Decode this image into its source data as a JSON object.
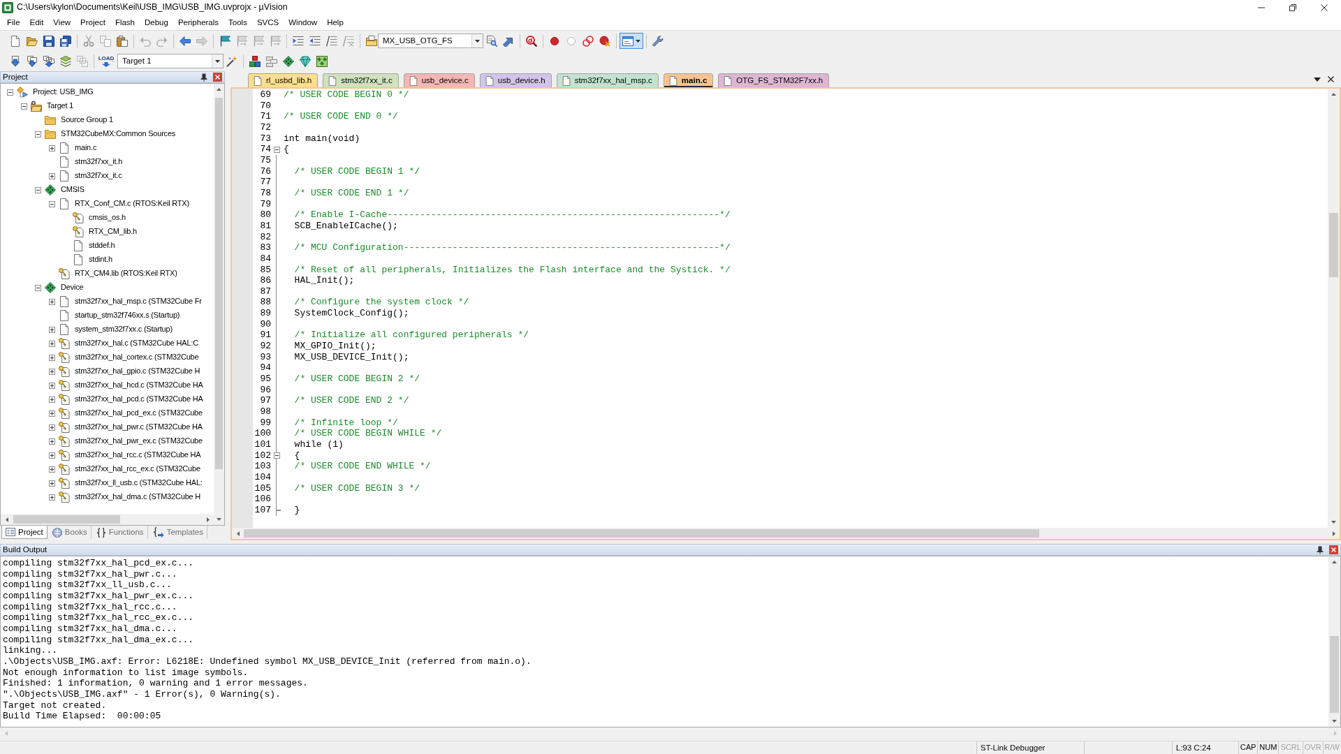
{
  "window": {
    "title": "C:\\Users\\kylon\\Documents\\Keil\\USB_IMG\\USB_IMG.uvprojx - µVision"
  },
  "menu": [
    "File",
    "Edit",
    "View",
    "Project",
    "Flash",
    "Debug",
    "Peripherals",
    "Tools",
    "SVCS",
    "Window",
    "Help"
  ],
  "toolbar_1": {
    "find_combo": {
      "value": "MX_USB_OTG_FS"
    },
    "window_button": {
      "on": true
    }
  },
  "toolbar_2": {
    "load_button": {
      "label": "LOAD"
    },
    "target_combo": {
      "value": "Target 1"
    }
  },
  "project_panel": {
    "title": "Project",
    "tree": [
      {
        "label": "Project: USB_IMG",
        "kind": "project",
        "expanded": true,
        "children": [
          {
            "label": "Target 1",
            "kind": "target",
            "expanded": true,
            "children": [
              {
                "label": "Source Group 1",
                "kind": "folder"
              },
              {
                "label": "STM32CubeMX:Common Sources",
                "kind": "folder",
                "expanded": true,
                "children": [
                  {
                    "label": "main.c",
                    "kind": "file",
                    "expanded": false
                  },
                  {
                    "label": "stm32f7xx_it.h",
                    "kind": "file"
                  },
                  {
                    "label": "stm32f7xx_it.c",
                    "kind": "file",
                    "expanded": false
                  }
                ]
              },
              {
                "label": "CMSIS",
                "kind": "component",
                "expanded": true,
                "children": [
                  {
                    "label": "RTX_Conf_CM.c (RTOS:Keil RTX)",
                    "kind": "file",
                    "expanded": true,
                    "children": [
                      {
                        "label": "cmsis_os.h",
                        "kind": "keyfile"
                      },
                      {
                        "label": "RTX_CM_lib.h",
                        "kind": "keyfile"
                      },
                      {
                        "label": "stddef.h",
                        "kind": "file"
                      },
                      {
                        "label": "stdint.h",
                        "kind": "file"
                      }
                    ]
                  },
                  {
                    "label": "RTX_CM4.lib (RTOS:Keil RTX)",
                    "kind": "keyfile"
                  }
                ]
              },
              {
                "label": "Device",
                "kind": "component",
                "expanded": true,
                "children": [
                  {
                    "label": "stm32f7xx_hal_msp.c (STM32Cube Fr",
                    "kind": "file",
                    "expanded": false
                  },
                  {
                    "label": "startup_stm32f746xx.s (Startup)",
                    "kind": "file"
                  },
                  {
                    "label": "system_stm32f7xx.c (Startup)",
                    "kind": "file",
                    "expanded": false
                  },
                  {
                    "label": "stm32f7xx_hal.c (STM32Cube HAL:C",
                    "kind": "keyfile",
                    "expanded": false
                  },
                  {
                    "label": "stm32f7xx_hal_cortex.c (STM32Cube",
                    "kind": "keyfile",
                    "expanded": false
                  },
                  {
                    "label": "stm32f7xx_hal_gpio.c (STM32Cube H",
                    "kind": "keyfile",
                    "expanded": false
                  },
                  {
                    "label": "stm32f7xx_hal_hcd.c (STM32Cube HA",
                    "kind": "keyfile",
                    "expanded": false
                  },
                  {
                    "label": "stm32f7xx_hal_pcd.c (STM32Cube HA",
                    "kind": "keyfile",
                    "expanded": false
                  },
                  {
                    "label": "stm32f7xx_hal_pcd_ex.c (STM32Cube",
                    "kind": "keyfile",
                    "expanded": false
                  },
                  {
                    "label": "stm32f7xx_hal_pwr.c (STM32Cube HA",
                    "kind": "keyfile",
                    "expanded": false
                  },
                  {
                    "label": "stm32f7xx_hal_pwr_ex.c (STM32Cube",
                    "kind": "keyfile",
                    "expanded": false
                  },
                  {
                    "label": "stm32f7xx_hal_rcc.c (STM32Cube HA",
                    "kind": "keyfile",
                    "expanded": false
                  },
                  {
                    "label": "stm32f7xx_hal_rcc_ex.c (STM32Cube",
                    "kind": "keyfile",
                    "expanded": false
                  },
                  {
                    "label": "stm32f7xx_ll_usb.c (STM32Cube HAL:",
                    "kind": "keyfile",
                    "expanded": false
                  },
                  {
                    "label": "stm32f7xx_hal_dma.c (STM32Cube H",
                    "kind": "keyfile",
                    "expanded": false
                  }
                ]
              }
            ]
          }
        ]
      }
    ],
    "tabs": [
      {
        "label": "Project",
        "selected": true
      },
      {
        "label": "Books",
        "selected": false
      },
      {
        "label": "Functions",
        "selected": false
      },
      {
        "label": "Templates",
        "selected": false
      }
    ]
  },
  "editor": {
    "tabs": [
      {
        "label": "rl_usbd_lib.h",
        "color": "#fcdf8e",
        "selected": false
      },
      {
        "label": "stm32f7xx_it.c",
        "color": "#cfe2bd",
        "selected": false
      },
      {
        "label": "usb_device.c",
        "color": "#f5b7b5",
        "selected": false
      },
      {
        "label": "usb_device.h",
        "color": "#d2c4ec",
        "selected": false
      },
      {
        "label": "stm32f7xx_hal_msp.c",
        "color": "#c3e3d2",
        "selected": false
      },
      {
        "label": "main.c",
        "color": "#f9c492",
        "selected": true
      },
      {
        "label": "OTG_FS_STM32F7xx.h",
        "color": "#deb6d1",
        "selected": false
      }
    ],
    "lines": [
      {
        "number": "69",
        "text": "/* USER CODE BEGIN 0 */",
        "kind": "comment"
      },
      {
        "number": "70"
      },
      {
        "number": "71",
        "text": "/* USER CODE END 0 */",
        "kind": "comment"
      },
      {
        "number": "72"
      },
      {
        "number": "73",
        "text": "int main(void)",
        "kind": "code"
      },
      {
        "number": "74",
        "text": "{",
        "kind": "code",
        "expanded": true
      },
      {
        "number": "75"
      },
      {
        "number": "76",
        "text": "  /* USER CODE BEGIN 1 */",
        "kind": "comment"
      },
      {
        "number": "77"
      },
      {
        "number": "78",
        "text": "  /* USER CODE END 1 */",
        "kind": "comment"
      },
      {
        "number": "79"
      },
      {
        "number": "80",
        "text": "  /* Enable I-Cache-------------------------------------------------------------*/",
        "kind": "comment"
      },
      {
        "number": "81",
        "text": "  SCB_EnableICache();",
        "kind": "code"
      },
      {
        "number": "82"
      },
      {
        "number": "83",
        "text": "  /* MCU Configuration----------------------------------------------------------*/",
        "kind": "comment"
      },
      {
        "number": "84"
      },
      {
        "number": "85",
        "text": "  /* Reset of all peripherals, Initializes the Flash interface and the Systick. */",
        "kind": "comment"
      },
      {
        "number": "86",
        "text": "  HAL_Init();",
        "kind": "code"
      },
      {
        "number": "87"
      },
      {
        "number": "88",
        "text": "  /* Configure the system clock */",
        "kind": "comment"
      },
      {
        "number": "89",
        "text": "  SystemClock_Config();",
        "kind": "code"
      },
      {
        "number": "90"
      },
      {
        "number": "91",
        "text": "  /* Initialize all configured peripherals */",
        "kind": "comment"
      },
      {
        "number": "92",
        "text": "  MX_GPIO_Init();",
        "kind": "code"
      },
      {
        "number": "93",
        "text": "  MX_USB_DEVICE_Init();",
        "kind": "code"
      },
      {
        "number": "94"
      },
      {
        "number": "95",
        "text": "  /* USER CODE BEGIN 2 */",
        "kind": "comment"
      },
      {
        "number": "96"
      },
      {
        "number": "97",
        "text": "  /* USER CODE END 2 */",
        "kind": "comment"
      },
      {
        "number": "98"
      },
      {
        "number": "99",
        "text": "  /* Infinite loop */",
        "kind": "comment"
      },
      {
        "number": "100",
        "text": "  /* USER CODE BEGIN WHILE */",
        "kind": "comment"
      },
      {
        "number": "101",
        "text": "  while (1)",
        "kind": "code"
      },
      {
        "number": "102",
        "text": "  {",
        "kind": "code",
        "expanded": true
      },
      {
        "number": "103",
        "text": "  /* USER CODE END WHILE */",
        "kind": "comment"
      },
      {
        "number": "104"
      },
      {
        "number": "105",
        "text": "  /* USER CODE BEGIN 3 */",
        "kind": "comment"
      },
      {
        "number": "106"
      },
      {
        "number": "107",
        "text": "  }",
        "kind": "code",
        "fold_end": true
      }
    ]
  },
  "build_output": {
    "title": "Build Output",
    "lines": [
      "compiling stm32f7xx_hal_pcd_ex.c...",
      "compiling stm32f7xx_hal_pwr.c...",
      "compiling stm32f7xx_ll_usb.c...",
      "compiling stm32f7xx_hal_pwr_ex.c...",
      "compiling stm32f7xx_hal_rcc.c...",
      "compiling stm32f7xx_hal_rcc_ex.c...",
      "compiling stm32f7xx_hal_dma.c...",
      "compiling stm32f7xx_hal_dma_ex.c...",
      "linking...",
      ".\\Objects\\USB_IMG.axf: Error: L6218E: Undefined symbol MX_USB_DEVICE_Init (referred from main.o).",
      "Not enough information to list image symbols.",
      "Finished: 1 information, 0 warning and 1 error messages.",
      "\".\\Objects\\USB_IMG.axf\" - 1 Error(s), 0 Warning(s).",
      "Target not created.",
      "Build Time Elapsed:  00:00:05"
    ]
  },
  "status_bar": {
    "panes": [
      "ST-Link Debugger",
      "L:93 C:24"
    ],
    "indicators": [
      {
        "label": "CAP",
        "on": true
      },
      {
        "label": "NUM",
        "on": true
      },
      {
        "label": "SCRL",
        "on": false
      },
      {
        "label": "OVR",
        "on": false
      },
      {
        "label": "R/W",
        "on": false
      }
    ]
  }
}
